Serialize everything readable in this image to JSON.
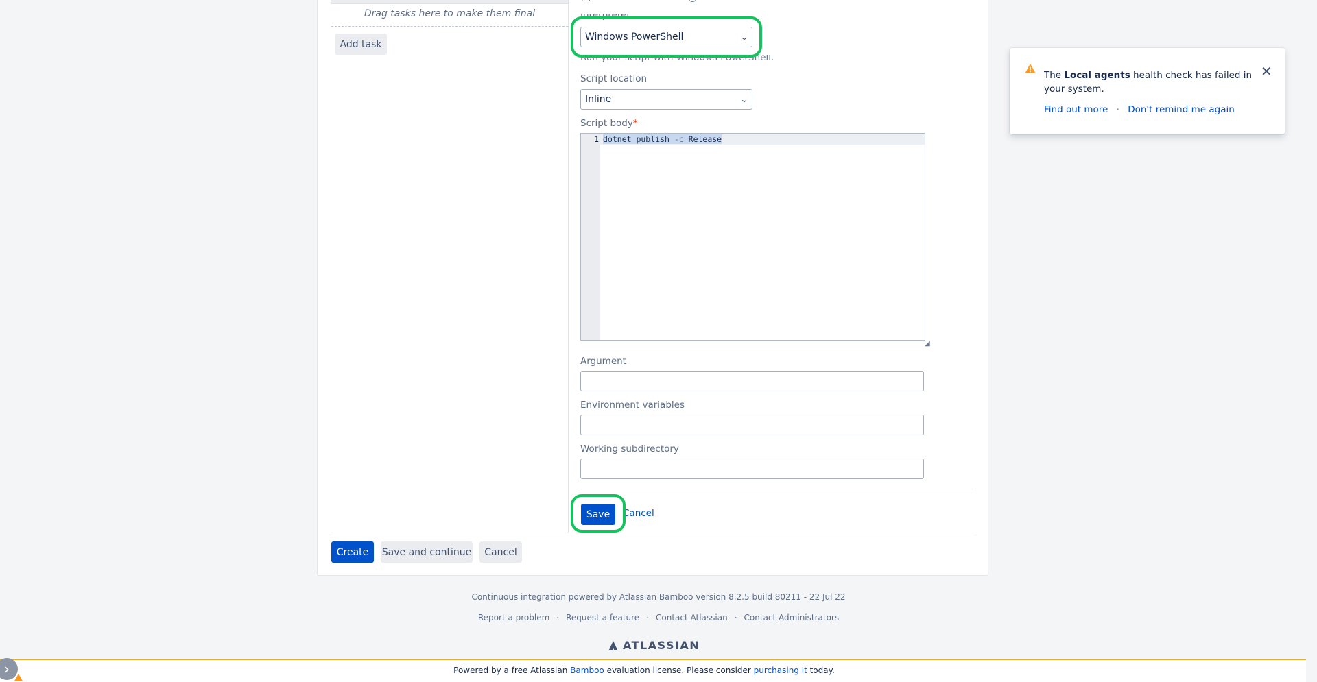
{
  "tasks_panel": {
    "drag_final_text": "Drag tasks here to make them final",
    "add_task_label": "Add task"
  },
  "form": {
    "interpreter_label": "Interpreter",
    "interpreter_value": "Windows PowerShell",
    "interpreter_description": "Run your script with Windows PowerShell.",
    "script_location_label": "Script location",
    "script_location_value": "Inline",
    "script_body_label": "Script body",
    "required_marker": "*",
    "script_line_number": "1",
    "script_code": {
      "part1": "dotnet publish ",
      "part2": "-c",
      "part3": " Release"
    },
    "argument_label": "Argument",
    "argument_value": "",
    "env_vars_label": "Environment variables",
    "env_vars_value": "",
    "working_subdir_label": "Working subdirectory",
    "working_subdir_value": "",
    "save_label": "Save",
    "cancel_label": "Cancel"
  },
  "actions": {
    "create_label": "Create",
    "save_continue_label": "Save and continue",
    "cancel_label": "Cancel"
  },
  "notification": {
    "text_pre": "The ",
    "text_bold": "Local agents",
    "text_post": " health check has failed in your system.",
    "find_out_more": "Find out more",
    "separator": "·",
    "dont_remind": "Don't remind me again"
  },
  "footer": {
    "powered_text": "Continuous integration powered by Atlassian Bamboo version 8.2.5 build 80211 - 22 Jul 22",
    "links": [
      "Report a problem",
      "Request a feature",
      "Contact Atlassian",
      "Contact Administrators"
    ],
    "separator": "·",
    "logo_text": "ATLASSIAN",
    "license_pre": "Powered by a free Atlassian ",
    "license_link1": "Bamboo",
    "license_mid": " evaluation license. Please consider ",
    "license_link2": "purchasing it",
    "license_post": " today."
  },
  "colors": {
    "primary": "#0052cc",
    "highlight": "#15c35e",
    "warning": "#ff991f",
    "license_border": "#f6a623"
  }
}
